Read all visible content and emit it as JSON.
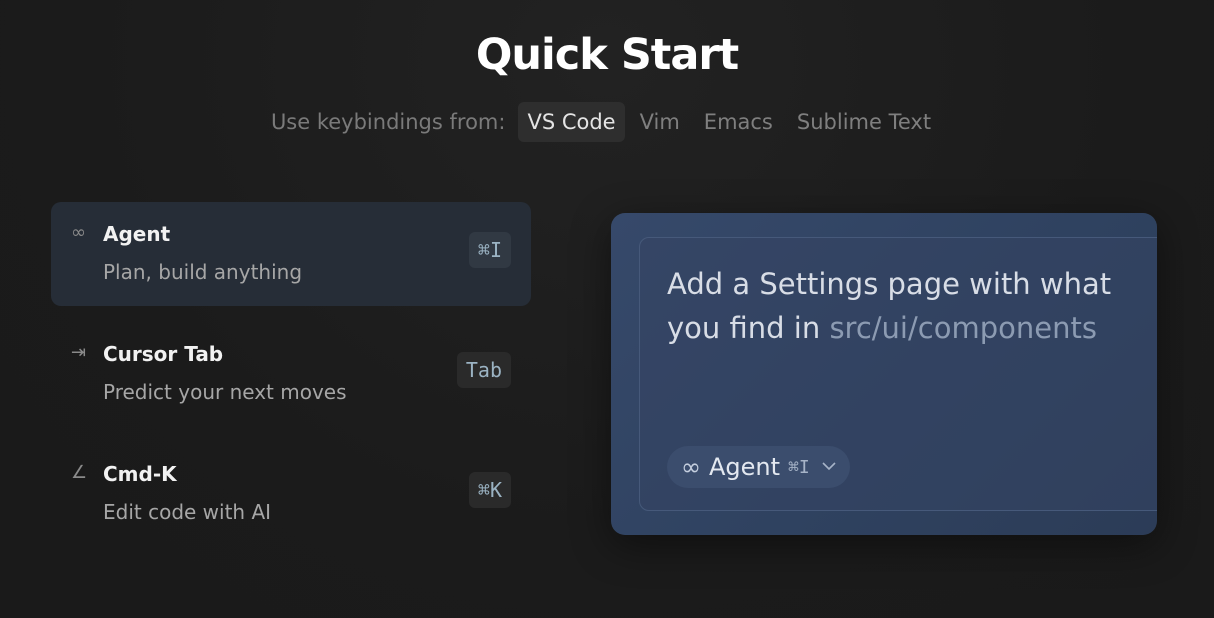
{
  "page": {
    "title": "Quick Start"
  },
  "keybindings": {
    "label": "Use keybindings from:",
    "options": [
      {
        "label": "VS Code",
        "active": true
      },
      {
        "label": "Vim",
        "active": false
      },
      {
        "label": "Emacs",
        "active": false
      },
      {
        "label": "Sublime Text",
        "active": false
      }
    ]
  },
  "features": [
    {
      "icon": "infinity-icon",
      "glyph": "∞",
      "name": "Agent",
      "description": "Plan, build anything",
      "shortcut": "⌘I",
      "active": true
    },
    {
      "icon": "tab-arrow-icon",
      "glyph": "⇥",
      "name": "Cursor Tab",
      "description": "Predict your next moves",
      "shortcut": "Tab",
      "active": false
    },
    {
      "icon": "pencil-edit-icon",
      "glyph": "∠",
      "name": "Cmd-K",
      "description": "Edit code with AI",
      "shortcut": "⌘K",
      "active": false
    }
  ],
  "preview": {
    "prompt_text": "Add a Settings page with what you find in ",
    "prompt_path": "src/ui/components",
    "mode": {
      "icon": "infinity-icon",
      "glyph": "∞",
      "name": "Agent",
      "shortcut": "⌘I"
    }
  },
  "colors": {
    "background": "#1b1b1b",
    "active_feature_bg": "#262d37",
    "preview_bg": "#36496a",
    "shortcut_text": "#9bb3c3"
  }
}
